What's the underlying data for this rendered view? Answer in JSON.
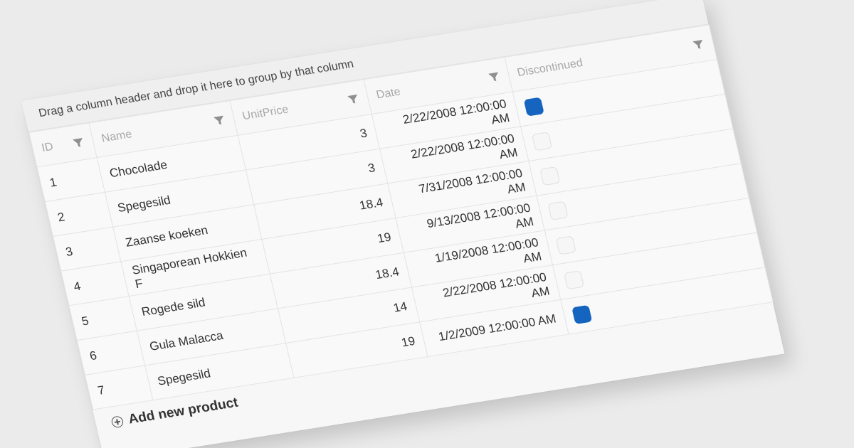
{
  "group_panel": {
    "text": "Drag a column header and drop it here to group by that column"
  },
  "columns": [
    {
      "label": "ID",
      "filterable": true
    },
    {
      "label": "Name",
      "filterable": true
    },
    {
      "label": "UnitPrice",
      "filterable": true
    },
    {
      "label": "Date",
      "filterable": true
    },
    {
      "label": "Discontinued",
      "filterable": true
    }
  ],
  "rows": [
    {
      "id": "1",
      "name": "Chocolade",
      "price": "3",
      "date": "2/22/2008 12:00:00 AM",
      "discontinued": true
    },
    {
      "id": "2",
      "name": "Spegesild",
      "price": "3",
      "date": "2/22/2008 12:00:00 AM",
      "discontinued": false
    },
    {
      "id": "3",
      "name": "Zaanse koeken",
      "price": "18.4",
      "date": "7/31/2008 12:00:00 AM",
      "discontinued": false
    },
    {
      "id": "4",
      "name": "Singaporean Hokkien F",
      "price": "19",
      "date": "9/13/2008 12:00:00 AM",
      "discontinued": false
    },
    {
      "id": "5",
      "name": "Rogede sild",
      "price": "18.4",
      "date": "1/19/2008 12:00:00 AM",
      "discontinued": false
    },
    {
      "id": "6",
      "name": "Gula Malacca",
      "price": "14",
      "date": "2/22/2008 12:00:00 AM",
      "discontinued": false
    },
    {
      "id": "7",
      "name": "Spegesild",
      "price": "19",
      "date": "1/2/2009 12:00:00 AM",
      "discontinued": true
    }
  ],
  "footer": {
    "add_label": "Add new product",
    "icon": "plus-circle-icon"
  },
  "colors": {
    "checked": "#1565c0",
    "background": "#ebebeb",
    "grid": "#f7f7f7"
  }
}
